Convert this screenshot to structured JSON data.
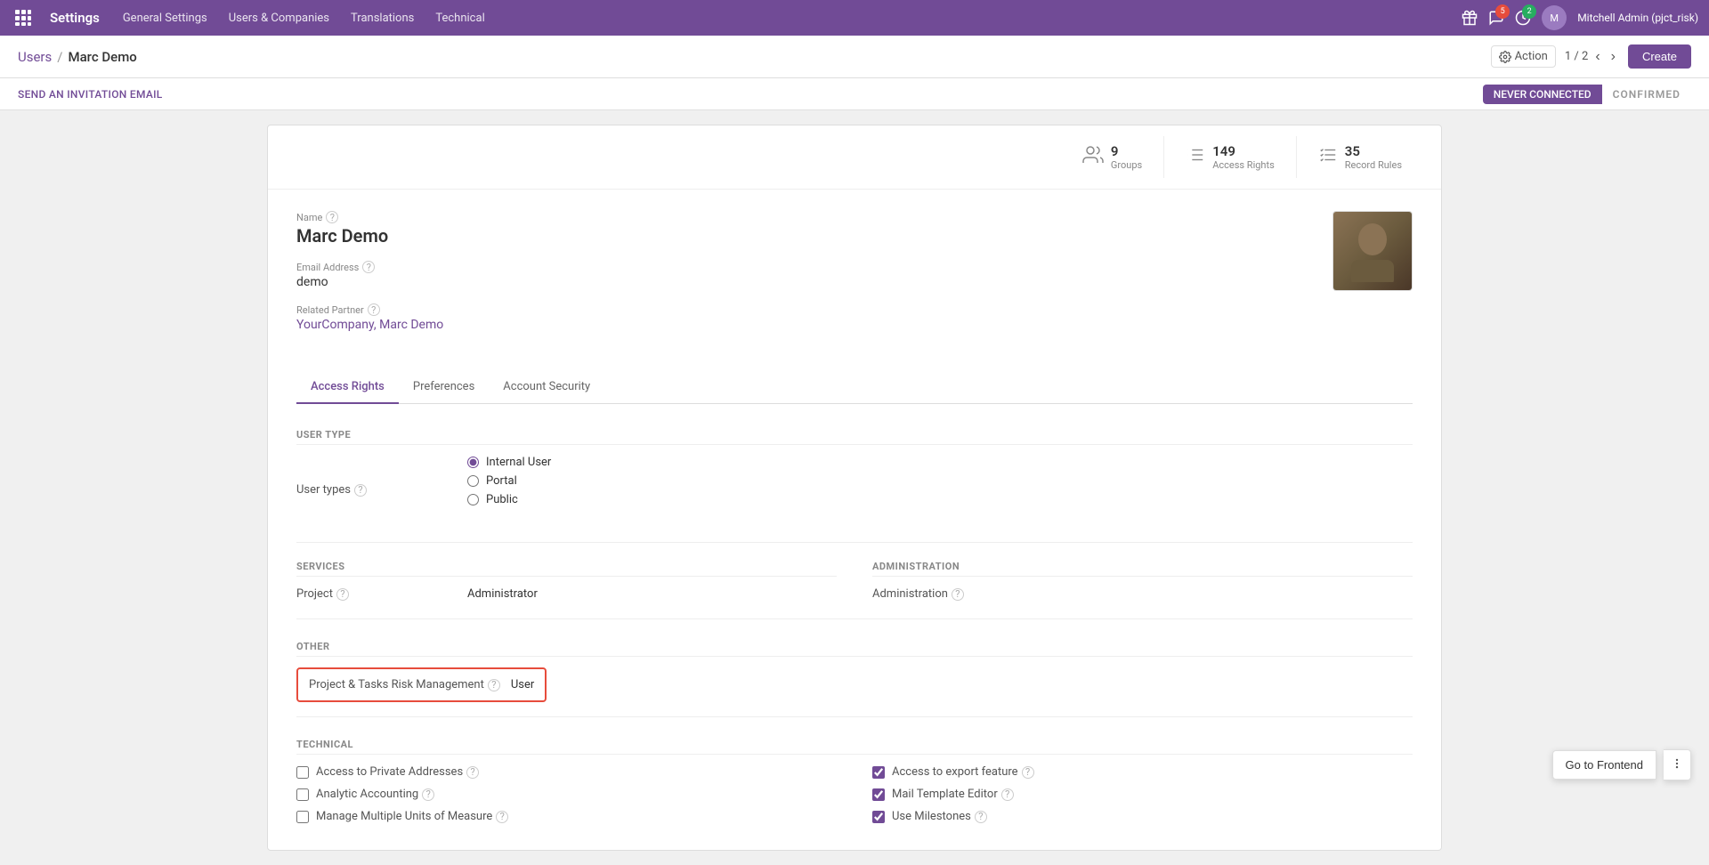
{
  "app": {
    "name": "Settings",
    "nav_links": [
      "General Settings",
      "Users & Companies",
      "Translations",
      "Technical"
    ]
  },
  "header": {
    "breadcrumb_parent": "Users",
    "breadcrumb_current": "Marc Demo",
    "action_label": "Action",
    "page_current": "1",
    "page_total": "2",
    "create_label": "Create"
  },
  "action_bar": {
    "send_invite_label": "SEND AN INVITATION EMAIL",
    "status_never": "NEVER CONNECTED",
    "status_confirmed": "CONFIRMED"
  },
  "stats": {
    "groups_count": "9",
    "groups_label": "Groups",
    "access_rights_count": "149",
    "access_rights_label": "Access Rights",
    "record_rules_count": "35",
    "record_rules_label": "Record Rules"
  },
  "form": {
    "name_label": "Name",
    "name_value": "Marc Demo",
    "email_label": "Email Address",
    "email_value": "demo",
    "partner_label": "Related Partner",
    "partner_value": "YourCompany, Marc Demo",
    "help_icon": "?"
  },
  "tabs": [
    {
      "id": "access_rights",
      "label": "Access Rights",
      "active": true
    },
    {
      "id": "preferences",
      "label": "Preferences",
      "active": false
    },
    {
      "id": "account_security",
      "label": "Account Security",
      "active": false
    }
  ],
  "user_type": {
    "section_label": "USER TYPE",
    "field_label": "User types",
    "options": [
      {
        "id": "internal",
        "label": "Internal User",
        "checked": true
      },
      {
        "id": "portal",
        "label": "Portal",
        "checked": false
      },
      {
        "id": "public",
        "label": "Public",
        "checked": false
      }
    ]
  },
  "services": {
    "section_label": "SERVICES",
    "fields": [
      {
        "name": "Project",
        "value": "Administrator"
      }
    ]
  },
  "administration": {
    "section_label": "ADMINISTRATION",
    "fields": [
      {
        "name": "Administration",
        "value": ""
      }
    ]
  },
  "other": {
    "section_label": "OTHER",
    "fields": [
      {
        "name": "Project & Tasks Risk Management",
        "value": "User",
        "highlighted": true
      }
    ]
  },
  "technical": {
    "section_label": "TECHNICAL",
    "left_fields": [
      {
        "name": "Access to Private Addresses",
        "checked": false
      },
      {
        "name": "Analytic Accounting",
        "checked": false
      },
      {
        "name": "Manage Multiple Units of Measure",
        "checked": false
      }
    ],
    "right_fields": [
      {
        "name": "Access to export feature",
        "checked": true
      },
      {
        "name": "Mail Template Editor",
        "checked": true
      },
      {
        "name": "Use Milestones",
        "checked": true
      }
    ]
  },
  "bottom": {
    "go_frontend_label": "Go to Frontend"
  }
}
